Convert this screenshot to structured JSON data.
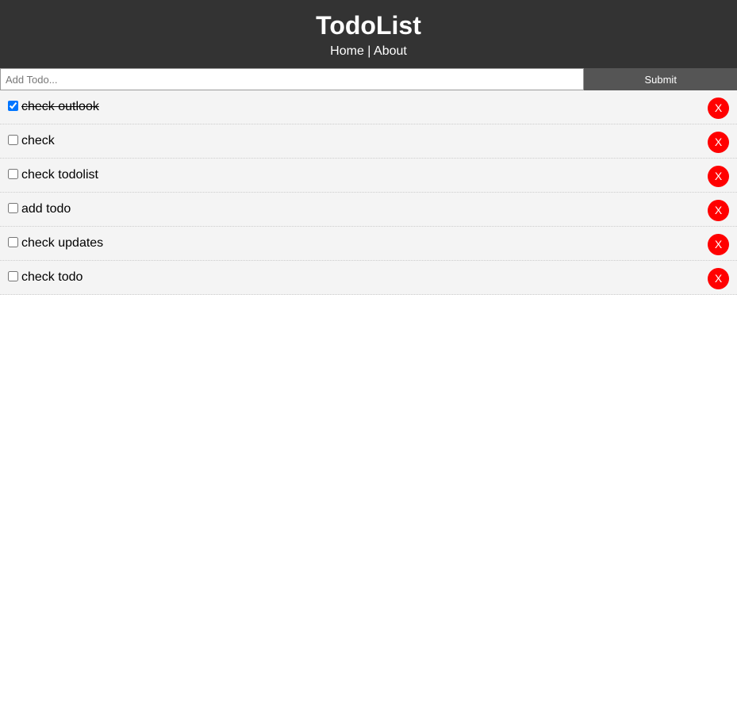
{
  "header": {
    "title": "TodoList",
    "nav": [
      {
        "label": "Home"
      },
      {
        "label": "About"
      }
    ],
    "separator": "|"
  },
  "add_form": {
    "input_value": "",
    "placeholder": "Add Todo...",
    "submit_label": "Submit"
  },
  "todos": [
    {
      "title": "check outlook",
      "completed": true,
      "delete_label": "X"
    },
    {
      "title": "check",
      "completed": false,
      "delete_label": "X"
    },
    {
      "title": "check todolist",
      "completed": false,
      "delete_label": "X"
    },
    {
      "title": "add todo",
      "completed": false,
      "delete_label": "X"
    },
    {
      "title": "check updates",
      "completed": false,
      "delete_label": "X"
    },
    {
      "title": "check todo",
      "completed": false,
      "delete_label": "X"
    }
  ],
  "colors": {
    "header_bg": "#333333",
    "submit_bg": "#555555",
    "item_bg": "#f4f4f4",
    "delete_bg": "#ff0000"
  }
}
